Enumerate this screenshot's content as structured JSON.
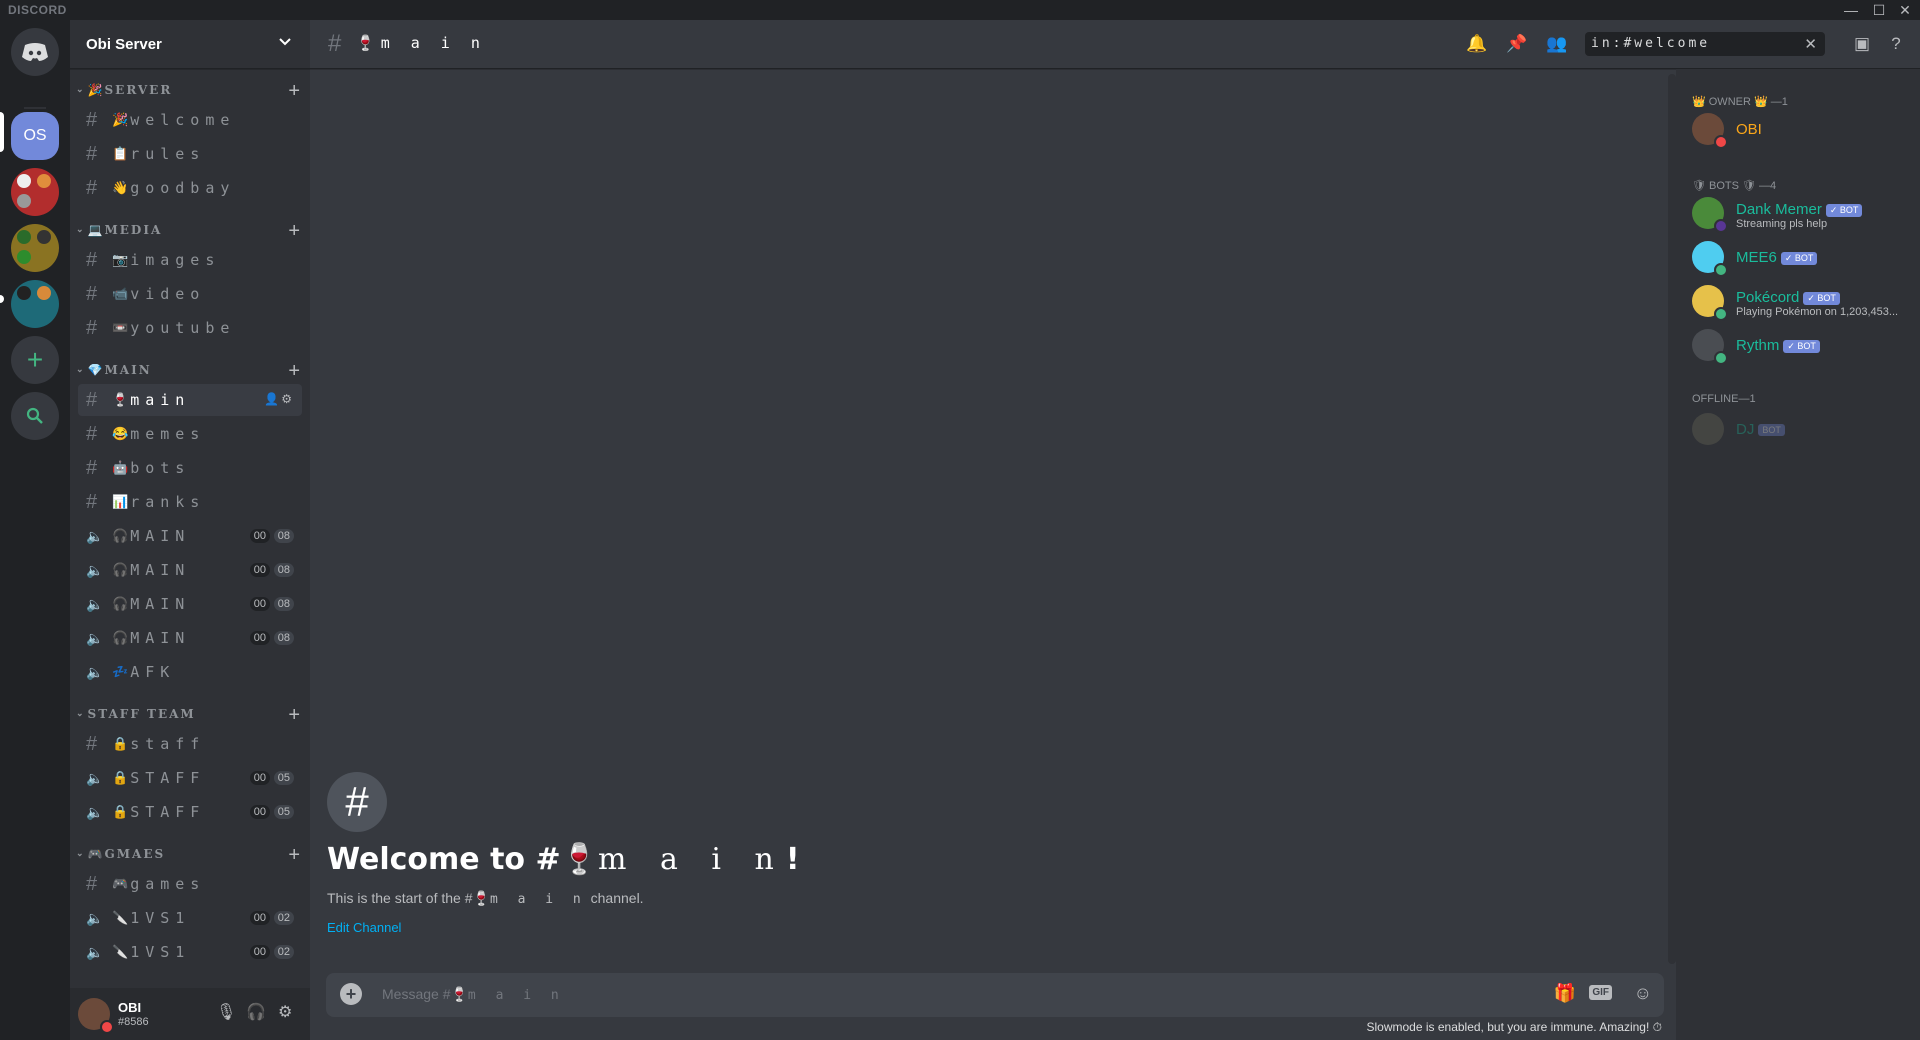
{
  "window": {
    "brand": "DISCORD",
    "controls": [
      "—",
      "☐",
      "✕"
    ]
  },
  "guilds": {
    "active_label": "OS"
  },
  "server": {
    "name": "Obi Server"
  },
  "categories": [
    {
      "name": "SERVER",
      "emoji": "🎉",
      "channels": [
        {
          "type": "text",
          "emoji": "🎉",
          "name": "welcome"
        },
        {
          "type": "text",
          "emoji": "📋",
          "name": "rules"
        },
        {
          "type": "text",
          "emoji": "👋",
          "name": "goodbay"
        }
      ]
    },
    {
      "name": "MEDIA",
      "emoji": "💻",
      "channels": [
        {
          "type": "text",
          "emoji": "📷",
          "name": "images"
        },
        {
          "type": "text",
          "emoji": "📹",
          "name": "video"
        },
        {
          "type": "text",
          "emoji": "📼",
          "name": "youtube"
        }
      ]
    },
    {
      "name": "MAIN",
      "emoji": "💎",
      "channels": [
        {
          "type": "text",
          "emoji": "🍷",
          "name": "main",
          "active": true
        },
        {
          "type": "text",
          "emoji": "😂",
          "name": "memes"
        },
        {
          "type": "text",
          "emoji": "🤖",
          "name": "bots"
        },
        {
          "type": "text",
          "emoji": "📊",
          "name": "ranks"
        },
        {
          "type": "voice",
          "emoji": "🎧",
          "name": "MAIN",
          "b1": "00",
          "b2": "08"
        },
        {
          "type": "voice",
          "emoji": "🎧",
          "name": "MAIN",
          "b1": "00",
          "b2": "08"
        },
        {
          "type": "voice",
          "emoji": "🎧",
          "name": "MAIN",
          "b1": "00",
          "b2": "08"
        },
        {
          "type": "voice",
          "emoji": "🎧",
          "name": "MAIN",
          "b1": "00",
          "b2": "08"
        },
        {
          "type": "voice",
          "emoji": "💤",
          "name": "AFK"
        }
      ]
    },
    {
      "name": "STAFF TEAM",
      "emoji": "",
      "channels": [
        {
          "type": "text",
          "emoji": "🔒",
          "name": "staff"
        },
        {
          "type": "voice",
          "emoji": "🔒",
          "name": "STAFF",
          "b1": "00",
          "b2": "05"
        },
        {
          "type": "voice",
          "emoji": "🔒",
          "name": "STAFF",
          "b1": "00",
          "b2": "05"
        }
      ]
    },
    {
      "name": "GMAES",
      "emoji": "🎮",
      "channels": [
        {
          "type": "text",
          "emoji": "🎮",
          "name": "games"
        },
        {
          "type": "voice",
          "emoji": "🔪",
          "name": "1VS1",
          "b1": "00",
          "b2": "02"
        },
        {
          "type": "voice",
          "emoji": "🔪",
          "name": "1VS1",
          "b1": "00",
          "b2": "02"
        }
      ]
    }
  ],
  "user": {
    "name": "OBI",
    "tag": "#8586"
  },
  "channel": {
    "emoji": "🍷",
    "name": "m a i n"
  },
  "search": {
    "value": "in:#welcome"
  },
  "welcome": {
    "title_prefix": "Welcome to #",
    "emoji": "🍷",
    "name": "m a i n",
    "title_suffix": "!",
    "sub_prefix": "This is the start of the #",
    "sub_suffix": " channel.",
    "edit_link": "Edit Channel"
  },
  "composer": {
    "placeholder_prefix": "Message #",
    "placeholder_name": "m a i n"
  },
  "slowmode": "Slowmode is enabled, but you are immune. Amazing! ⏱",
  "members": {
    "groups": [
      {
        "label": "👑 OWNER 👑 —1"
      },
      {
        "label": "🛡 BOTS 🛡 —4"
      },
      {
        "label": "OFFLINE—1"
      }
    ],
    "owner": {
      "name": "OBI",
      "color": "#faa61a"
    },
    "bots": [
      {
        "name": "Dank Memer",
        "status": "Streaming pls help",
        "bot": "✓ BOT",
        "color": "#1abc9c"
      },
      {
        "name": "MEE6",
        "status": "",
        "bot": "✓ BOT",
        "color": "#1abc9c"
      },
      {
        "name": "Pokécord",
        "status": "Playing Pokémon on 1,203,453...",
        "bot": "✓ BOT",
        "color": "#1abc9c"
      },
      {
        "name": "Rythm",
        "status": "",
        "bot": "✓ BOT",
        "color": "#1abc9c"
      }
    ],
    "offline": [
      {
        "name": "DJ",
        "bot": "BOT",
        "color": "#1abc9c"
      }
    ]
  },
  "colors": {
    "blurple": "#7289da",
    "online": "#43b581",
    "dnd": "#f04747",
    "link": "#00b0f4"
  }
}
